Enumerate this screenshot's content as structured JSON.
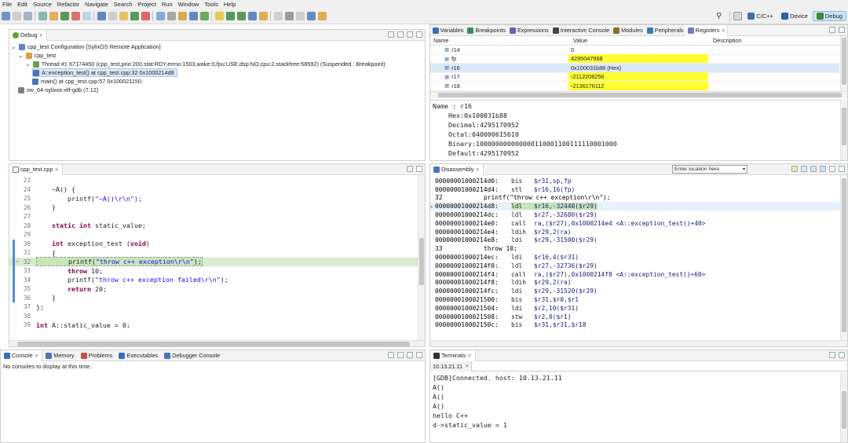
{
  "menubar": [
    "File",
    "Edit",
    "Source",
    "Refactor",
    "Navigate",
    "Search",
    "Project",
    "Run",
    "Window",
    "Tools",
    "Help"
  ],
  "perspectives": [
    {
      "label": "C/C++",
      "color": "#3d6fb6",
      "active": false
    },
    {
      "label": "Device",
      "color": "#2b5fb0",
      "active": false
    },
    {
      "label": "Debug",
      "color": "#3c8b3c",
      "active": true
    }
  ],
  "colors": {
    "highlight_yellow": "#ffff33",
    "accent": "#4a90d9",
    "debug_line": "#d8ecd0",
    "keyword": "#7f0055",
    "string": "#2a00ff"
  },
  "debug": {
    "tab_label": "Debug",
    "tree": [
      {
        "indent": 0,
        "text": "cpp_test Configuration [SylixOS Remote Application]",
        "icon": "#5a87c6",
        "expanded": true
      },
      {
        "indent": 1,
        "text": "cpp_test",
        "icon": "#d9a23a",
        "expanded": true
      },
      {
        "indent": 2,
        "text": "Thread #1 67174450 (cpp_test,prio:200,stat:RDY,errno:1503,wake:0,fpu:USE,dsp:NO,cpu:2,stackfree:58592) (Suspended : Breakpoint)",
        "icon": "#6b9f4a",
        "expanded": true
      },
      {
        "indent": 3,
        "text": "A::exception_test() at cpp_test.cpp:32 0x1000214d8",
        "icon": "#4b72b3",
        "selected": true
      },
      {
        "indent": 3,
        "text": "main() at cpp_test.cpp:57 0x100021150",
        "icon": "#4b72b3"
      },
      {
        "indent": 1,
        "text": "sw_64-sylixos-elf-gdb (7.12)",
        "icon": "#7f7f7f"
      }
    ]
  },
  "vars_tabs": [
    "Variables",
    "Breakpoints",
    "Expressions",
    "Interactive Console",
    "Modules",
    "Peripherals",
    "Registers"
  ],
  "registers": {
    "col_name": "Name",
    "col_value": "Value",
    "col_desc": "Description",
    "rows": [
      {
        "name": "r14",
        "value": "0",
        "highlight": false
      },
      {
        "name": "fp",
        "value": "4295047968",
        "highlight": true
      },
      {
        "name": "r16",
        "value": "0x100031b88 (Hex)",
        "highlight": false,
        "selected": true
      },
      {
        "name": "r17",
        "value": "-2112208256",
        "highlight": true
      },
      {
        "name": "r18",
        "value": "-2136176112",
        "highlight": true
      }
    ],
    "detail": [
      "Name : r16",
      "    Hex:0x100031b88",
      "    Decimal:4295170952",
      "    Octal:040000615610",
      "    Binary:100000000000000110001100111110001000",
      "    Default:4295170952"
    ]
  },
  "editor": {
    "tab_label": "cpp_test.cpp",
    "lines": [
      {
        "n": "23",
        "code": "",
        "mark": ""
      },
      {
        "n": "24",
        "code": "    ~A() {",
        "mark": ""
      },
      {
        "n": "25",
        "code": "        printf(\"~A()\\r\\n\");",
        "mark": ""
      },
      {
        "n": "26",
        "code": "    }",
        "mark": ""
      },
      {
        "n": "27",
        "code": "",
        "mark": ""
      },
      {
        "n": "28",
        "code": "    static int static_value;",
        "mark": ""
      },
      {
        "n": "29",
        "code": "",
        "mark": ""
      },
      {
        "n": "30",
        "code": "    int exception_test (void)",
        "mark": "bar"
      },
      {
        "n": "31",
        "code": "    {",
        "mark": "bar"
      },
      {
        "n": "32",
        "code": "        printf(\"throw c++ exception\\r\\n\");",
        "mark": "current"
      },
      {
        "n": "33",
        "code": "        throw 10;",
        "mark": "bar"
      },
      {
        "n": "34",
        "code": "        printf(\"throw c++ exception failed\\r\\n\");",
        "mark": "bar"
      },
      {
        "n": "35",
        "code": "        return 20;",
        "mark": "bar"
      },
      {
        "n": "36",
        "code": "    }",
        "mark": "bar"
      },
      {
        "n": "37",
        "code": "};",
        "mark": ""
      },
      {
        "n": "38",
        "code": "",
        "mark": ""
      },
      {
        "n": "39",
        "code": "int A::static_value = 0;",
        "mark": ""
      }
    ]
  },
  "disasm": {
    "tab_label": "Disassembly",
    "location_placeholder": "Enter location here",
    "lines": [
      {
        "type": "asm",
        "addr": "00000001000214d0:",
        "op": "bis",
        "args": "$r31,sp,fp"
      },
      {
        "type": "asm",
        "addr": "00000001000214d4:",
        "op": "stl",
        "args": "$r16,16(fp)"
      },
      {
        "type": "src",
        "num": "32",
        "text": "        printf(\"throw c++ exception\\r\\n\");"
      },
      {
        "type": "asm",
        "addr": "00000001000214d8:",
        "op": "ldl",
        "args": "$r16,-32440($r29)",
        "current": true
      },
      {
        "type": "asm",
        "addr": "00000001000214dc:",
        "op": "ldl",
        "args": "$r27,-32680($r29)"
      },
      {
        "type": "asm",
        "addr": "00000001000214e0:",
        "op": "call",
        "args": "ra,($r27),0x1000214e4 <A::exception_test()+40>"
      },
      {
        "type": "asm",
        "addr": "00000001000214e4:",
        "op": "ldih",
        "args": "$r29,2(ra)"
      },
      {
        "type": "asm",
        "addr": "00000001000214e8:",
        "op": "ldi",
        "args": "$r29,-31500($r29)"
      },
      {
        "type": "src",
        "num": "33",
        "text": "        throw 10;"
      },
      {
        "type": "asm",
        "addr": "00000001000214ec:",
        "op": "ldi",
        "args": "$r16,4($r31)"
      },
      {
        "type": "asm",
        "addr": "00000001000214f0:",
        "op": "ldl",
        "args": "$r27,-32736($r29)"
      },
      {
        "type": "asm",
        "addr": "00000001000214f4:",
        "op": "call",
        "args": "ra,($r27),0x1000214f8 <A::exception_test()+60>"
      },
      {
        "type": "asm",
        "addr": "00000001000214f8:",
        "op": "ldih",
        "args": "$r29,2(ra)"
      },
      {
        "type": "asm",
        "addr": "00000001000214fc:",
        "op": "ldi",
        "args": "$r29,-31520($r29)"
      },
      {
        "type": "asm",
        "addr": "0000000100021500:",
        "op": "bis",
        "args": "$r31,$r0,$r1"
      },
      {
        "type": "asm",
        "addr": "0000000100021504:",
        "op": "ldi",
        "args": "$r2,10($r31)"
      },
      {
        "type": "asm",
        "addr": "0000000100021508:",
        "op": "stw",
        "args": "$r2,0($r1)"
      },
      {
        "type": "asm",
        "addr": "000000010002150c:",
        "op": "bis",
        "args": "$r31,$r31,$r18"
      }
    ]
  },
  "console": {
    "tabs": [
      "Console",
      "Memory",
      "Problems",
      "Executables",
      "Debugger Console"
    ],
    "message": "No consoles to display at this time."
  },
  "terminal": {
    "tab_label": "Terminals",
    "session_tab": "10.13.21.11",
    "lines": [
      "[GDB]Connected. host: 10.13.21.11",
      "A()",
      "A()",
      "A()",
      "hello C++",
      "d->static_value = 1"
    ]
  }
}
